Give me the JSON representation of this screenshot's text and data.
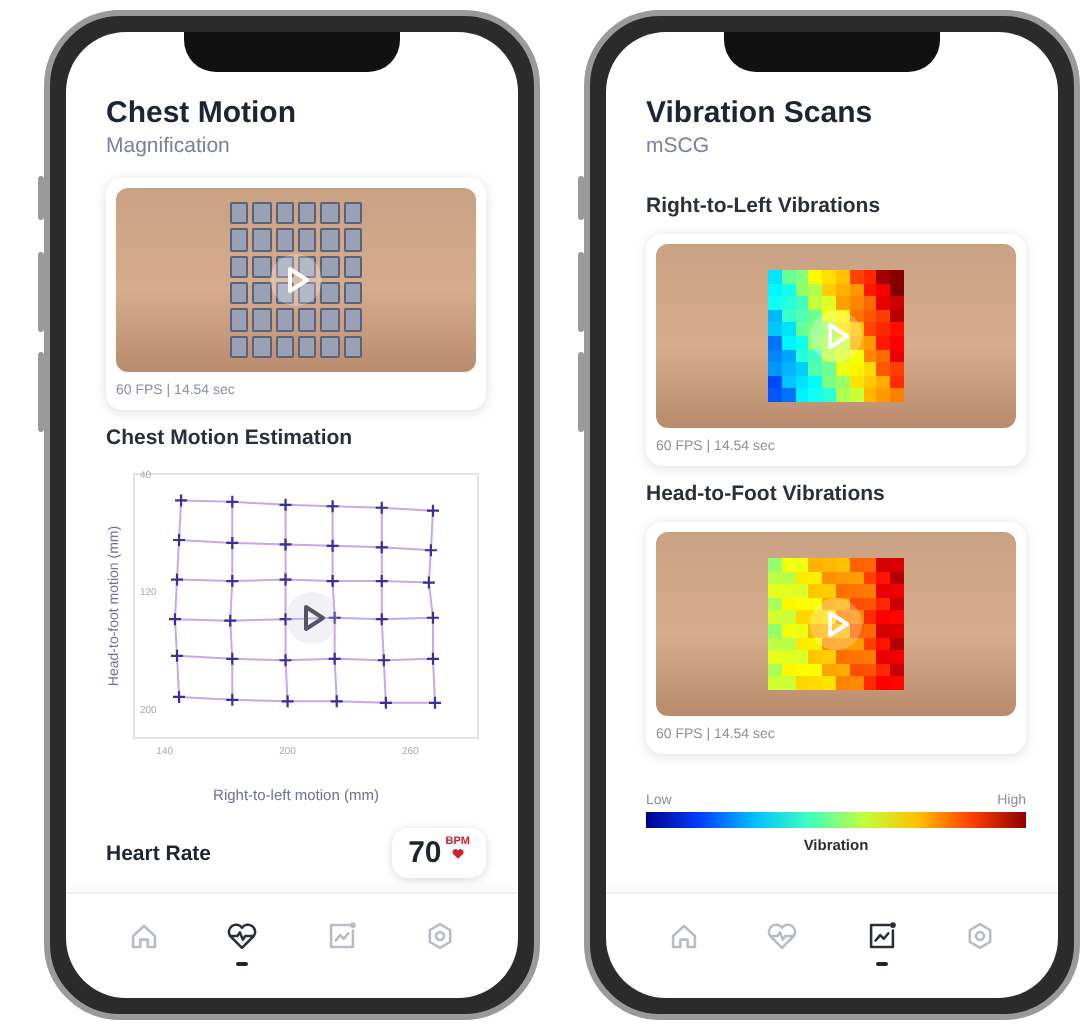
{
  "screens": [
    {
      "title": "Chest Motion",
      "subtitle": "Magnification",
      "sections": [
        {
          "kind": "video",
          "overlay": {
            "kind": "markers"
          },
          "caption": "60 FPS | 14.54 sec"
        },
        {
          "kind": "chart",
          "heading": "Chest Motion Estimation",
          "chart_data": {
            "type": "line",
            "xlabel": "Right-to-left motion (mm)",
            "ylabel": "Head-to-foot motion (mm)",
            "xlim": [
              125,
              293
            ],
            "ylim": [
              220,
              40
            ],
            "xticks": [
              140,
              200,
              260
            ],
            "yticks": [
              40,
              120,
              200
            ],
            "series": [
              {
                "color": "#3b2fa0",
                "marker": "+",
                "x": [
                  148,
                  173,
                  199,
                  222,
                  246,
                  271
                ],
                "values": [
                  58,
                  59,
                  61,
                  62,
                  63,
                  65
                ]
              },
              {
                "color": "#3b2fa0",
                "marker": "+",
                "x": [
                  147,
                  173,
                  199,
                  222,
                  246,
                  270
                ],
                "values": [
                  85,
                  87,
                  88,
                  89,
                  90,
                  92
                ]
              },
              {
                "color": "#3b2fa0",
                "marker": "+",
                "x": [
                  146,
                  173,
                  199,
                  222,
                  246,
                  269
                ],
                "values": [
                  112,
                  113,
                  112,
                  113,
                  113,
                  114
                ]
              },
              {
                "color": "#3b2fa0",
                "marker": "+",
                "x": [
                  145,
                  172,
                  199,
                  223,
                  246,
                  271
                ],
                "values": [
                  139,
                  140,
                  139,
                  138,
                  139,
                  138
                ]
              },
              {
                "color": "#3b2fa0",
                "marker": "+",
                "x": [
                  146,
                  173,
                  199,
                  223,
                  247,
                  271
                ],
                "values": [
                  164,
                  166,
                  167,
                  166,
                  167,
                  166
                ]
              },
              {
                "color": "#3b2fa0",
                "marker": "+",
                "x": [
                  147,
                  173,
                  200,
                  224,
                  248,
                  272
                ],
                "values": [
                  192,
                  194,
                  195,
                  195,
                  196,
                  196
                ]
              },
              {
                "color": "#c9a8e8",
                "x": [
                  148,
                  147,
                  146,
                  145,
                  146,
                  147
                ],
                "values": [
                  58,
                  85,
                  112,
                  139,
                  164,
                  192
                ]
              },
              {
                "color": "#c9a8e8",
                "x": [
                  173,
                  173,
                  173,
                  172,
                  173,
                  173
                ],
                "values": [
                  59,
                  87,
                  113,
                  140,
                  166,
                  194
                ]
              },
              {
                "color": "#c9a8e8",
                "x": [
                  199,
                  199,
                  199,
                  199,
                  199,
                  200
                ],
                "values": [
                  61,
                  88,
                  112,
                  139,
                  167,
                  195
                ]
              },
              {
                "color": "#c9a8e8",
                "x": [
                  222,
                  222,
                  222,
                  223,
                  223,
                  224
                ],
                "values": [
                  62,
                  89,
                  113,
                  138,
                  166,
                  195
                ]
              },
              {
                "color": "#c9a8e8",
                "x": [
                  246,
                  246,
                  246,
                  246,
                  247,
                  248
                ],
                "values": [
                  63,
                  90,
                  113,
                  139,
                  167,
                  196
                ]
              },
              {
                "color": "#c9a8e8",
                "x": [
                  271,
                  270,
                  269,
                  271,
                  271,
                  272
                ],
                "values": [
                  65,
                  92,
                  114,
                  138,
                  166,
                  196
                ]
              }
            ]
          }
        },
        {
          "kind": "metric",
          "label": "Heart Rate",
          "value": "70",
          "unit": "BPM"
        }
      ],
      "nav": [
        {
          "selected": false
        },
        {
          "selected": true
        },
        {
          "selected": false
        },
        {
          "selected": false
        }
      ]
    },
    {
      "title": "Vibration Scans",
      "subtitle": "mSCG",
      "sections": [
        {
          "kind": "video",
          "heading": "Right-to-Left Vibrations",
          "overlay": {
            "kind": "heatmap_diagonal"
          },
          "caption": "60 FPS | 14.54 sec"
        },
        {
          "kind": "video",
          "heading": "Head-to-Foot Vibrations",
          "overlay": {
            "kind": "heatmap_horizontal"
          },
          "caption": "60 FPS | 14.54 sec"
        },
        {
          "kind": "legend",
          "low": "Low",
          "high": "High",
          "label": "Vibration"
        }
      ],
      "nav": [
        {
          "selected": false
        },
        {
          "selected": false
        },
        {
          "selected": true
        },
        {
          "selected": false
        }
      ]
    }
  ]
}
